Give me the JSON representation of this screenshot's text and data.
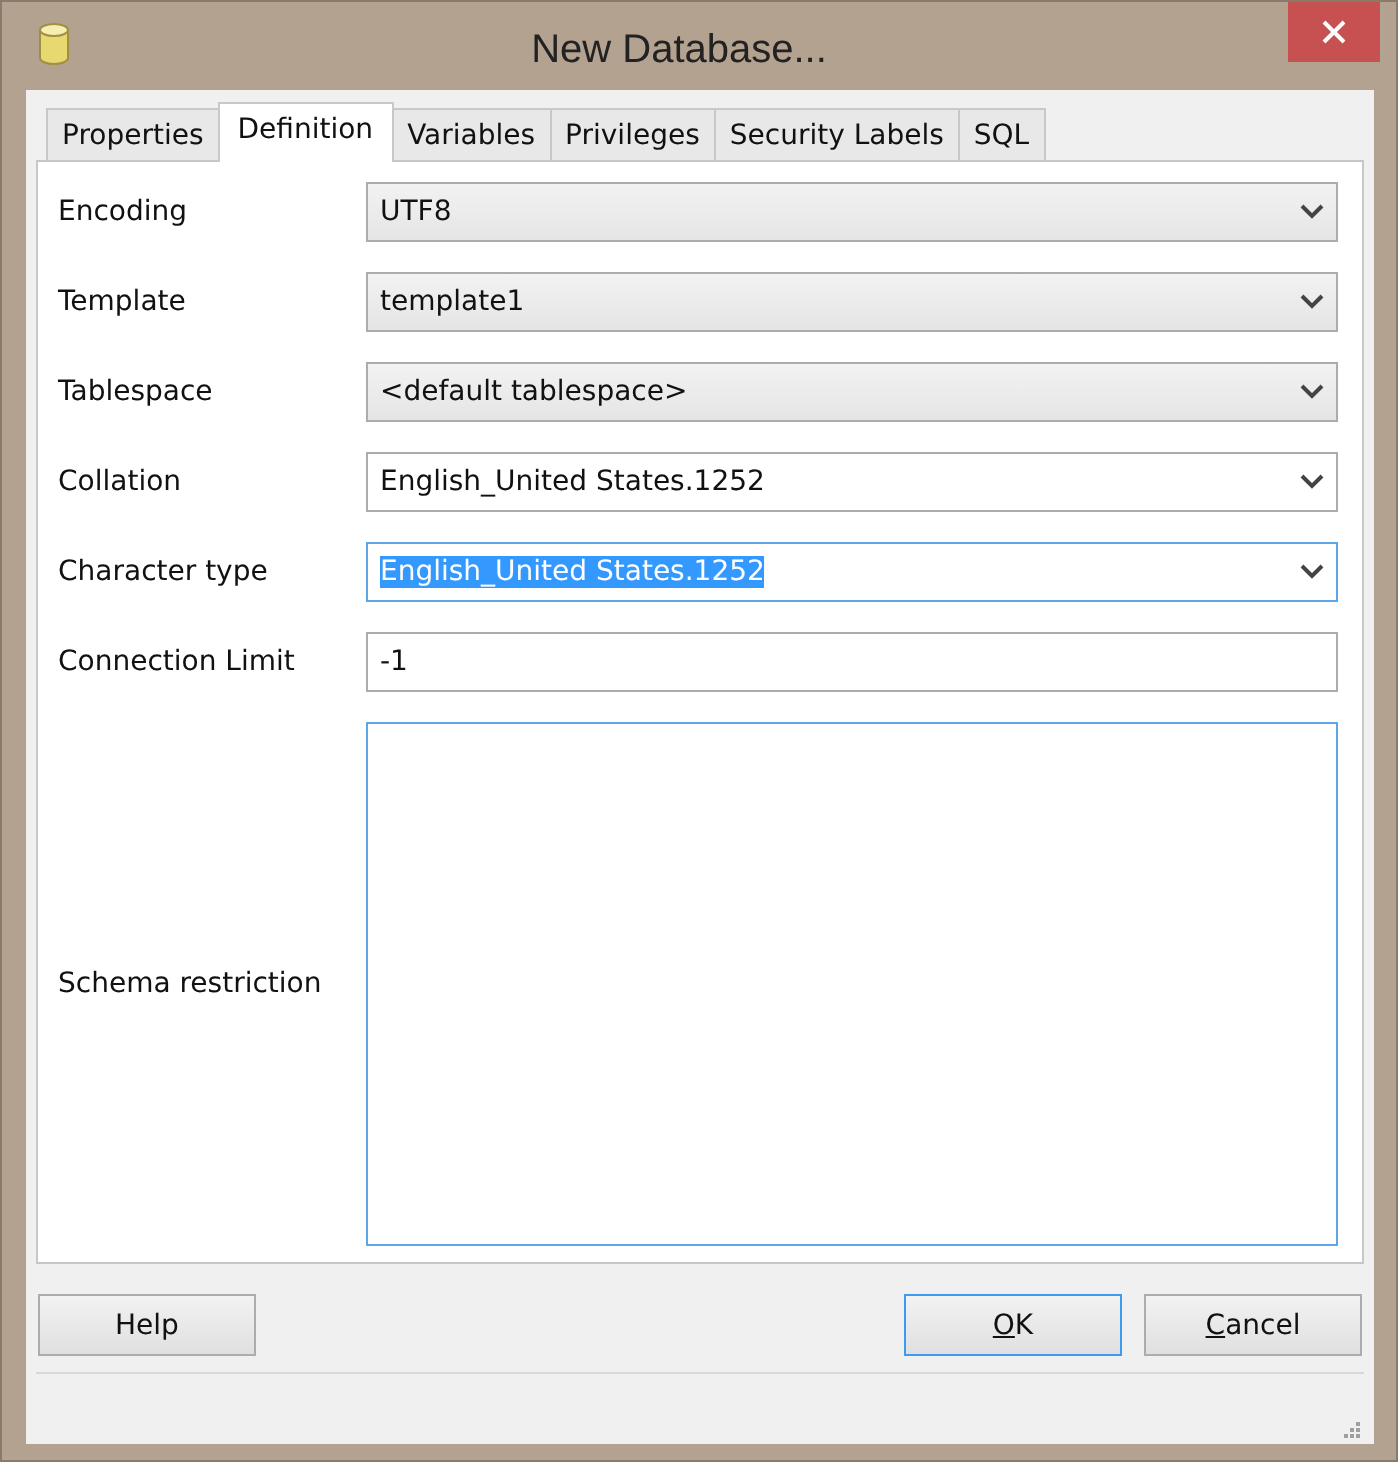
{
  "window": {
    "title": "New Database..."
  },
  "tabs": [
    {
      "label": "Properties",
      "selected": false
    },
    {
      "label": "Definition",
      "selected": true
    },
    {
      "label": "Variables",
      "selected": false
    },
    {
      "label": "Privileges",
      "selected": false
    },
    {
      "label": "Security Labels",
      "selected": false
    },
    {
      "label": "SQL",
      "selected": false
    }
  ],
  "fields": [
    {
      "label": "Encoding",
      "kind": "dropdown",
      "editable": false,
      "value": "UTF8",
      "focused": false
    },
    {
      "label": "Template",
      "kind": "dropdown",
      "editable": false,
      "value": "template1",
      "focused": false
    },
    {
      "label": "Tablespace",
      "kind": "dropdown",
      "editable": false,
      "value": "<default tablespace>",
      "focused": false
    },
    {
      "label": "Collation",
      "kind": "dropdown",
      "editable": true,
      "value": "English_United States.1252",
      "focused": false
    },
    {
      "label": "Character type",
      "kind": "dropdown",
      "editable": true,
      "value": "English_United States.1252",
      "focused": true
    },
    {
      "label": "Connection Limit",
      "kind": "text",
      "value": "-1",
      "focused": false
    },
    {
      "label": "Schema restriction",
      "kind": "textarea",
      "focused": true
    }
  ],
  "buttons": [
    {
      "label_rest": "Help",
      "default": false,
      "kind": "auxiliary"
    },
    {
      "access_key": "O",
      "label_rest": "K",
      "default": true,
      "kind": "action"
    },
    {
      "access_key": "C",
      "label_rest": "ancel",
      "default": false,
      "kind": "action"
    }
  ]
}
